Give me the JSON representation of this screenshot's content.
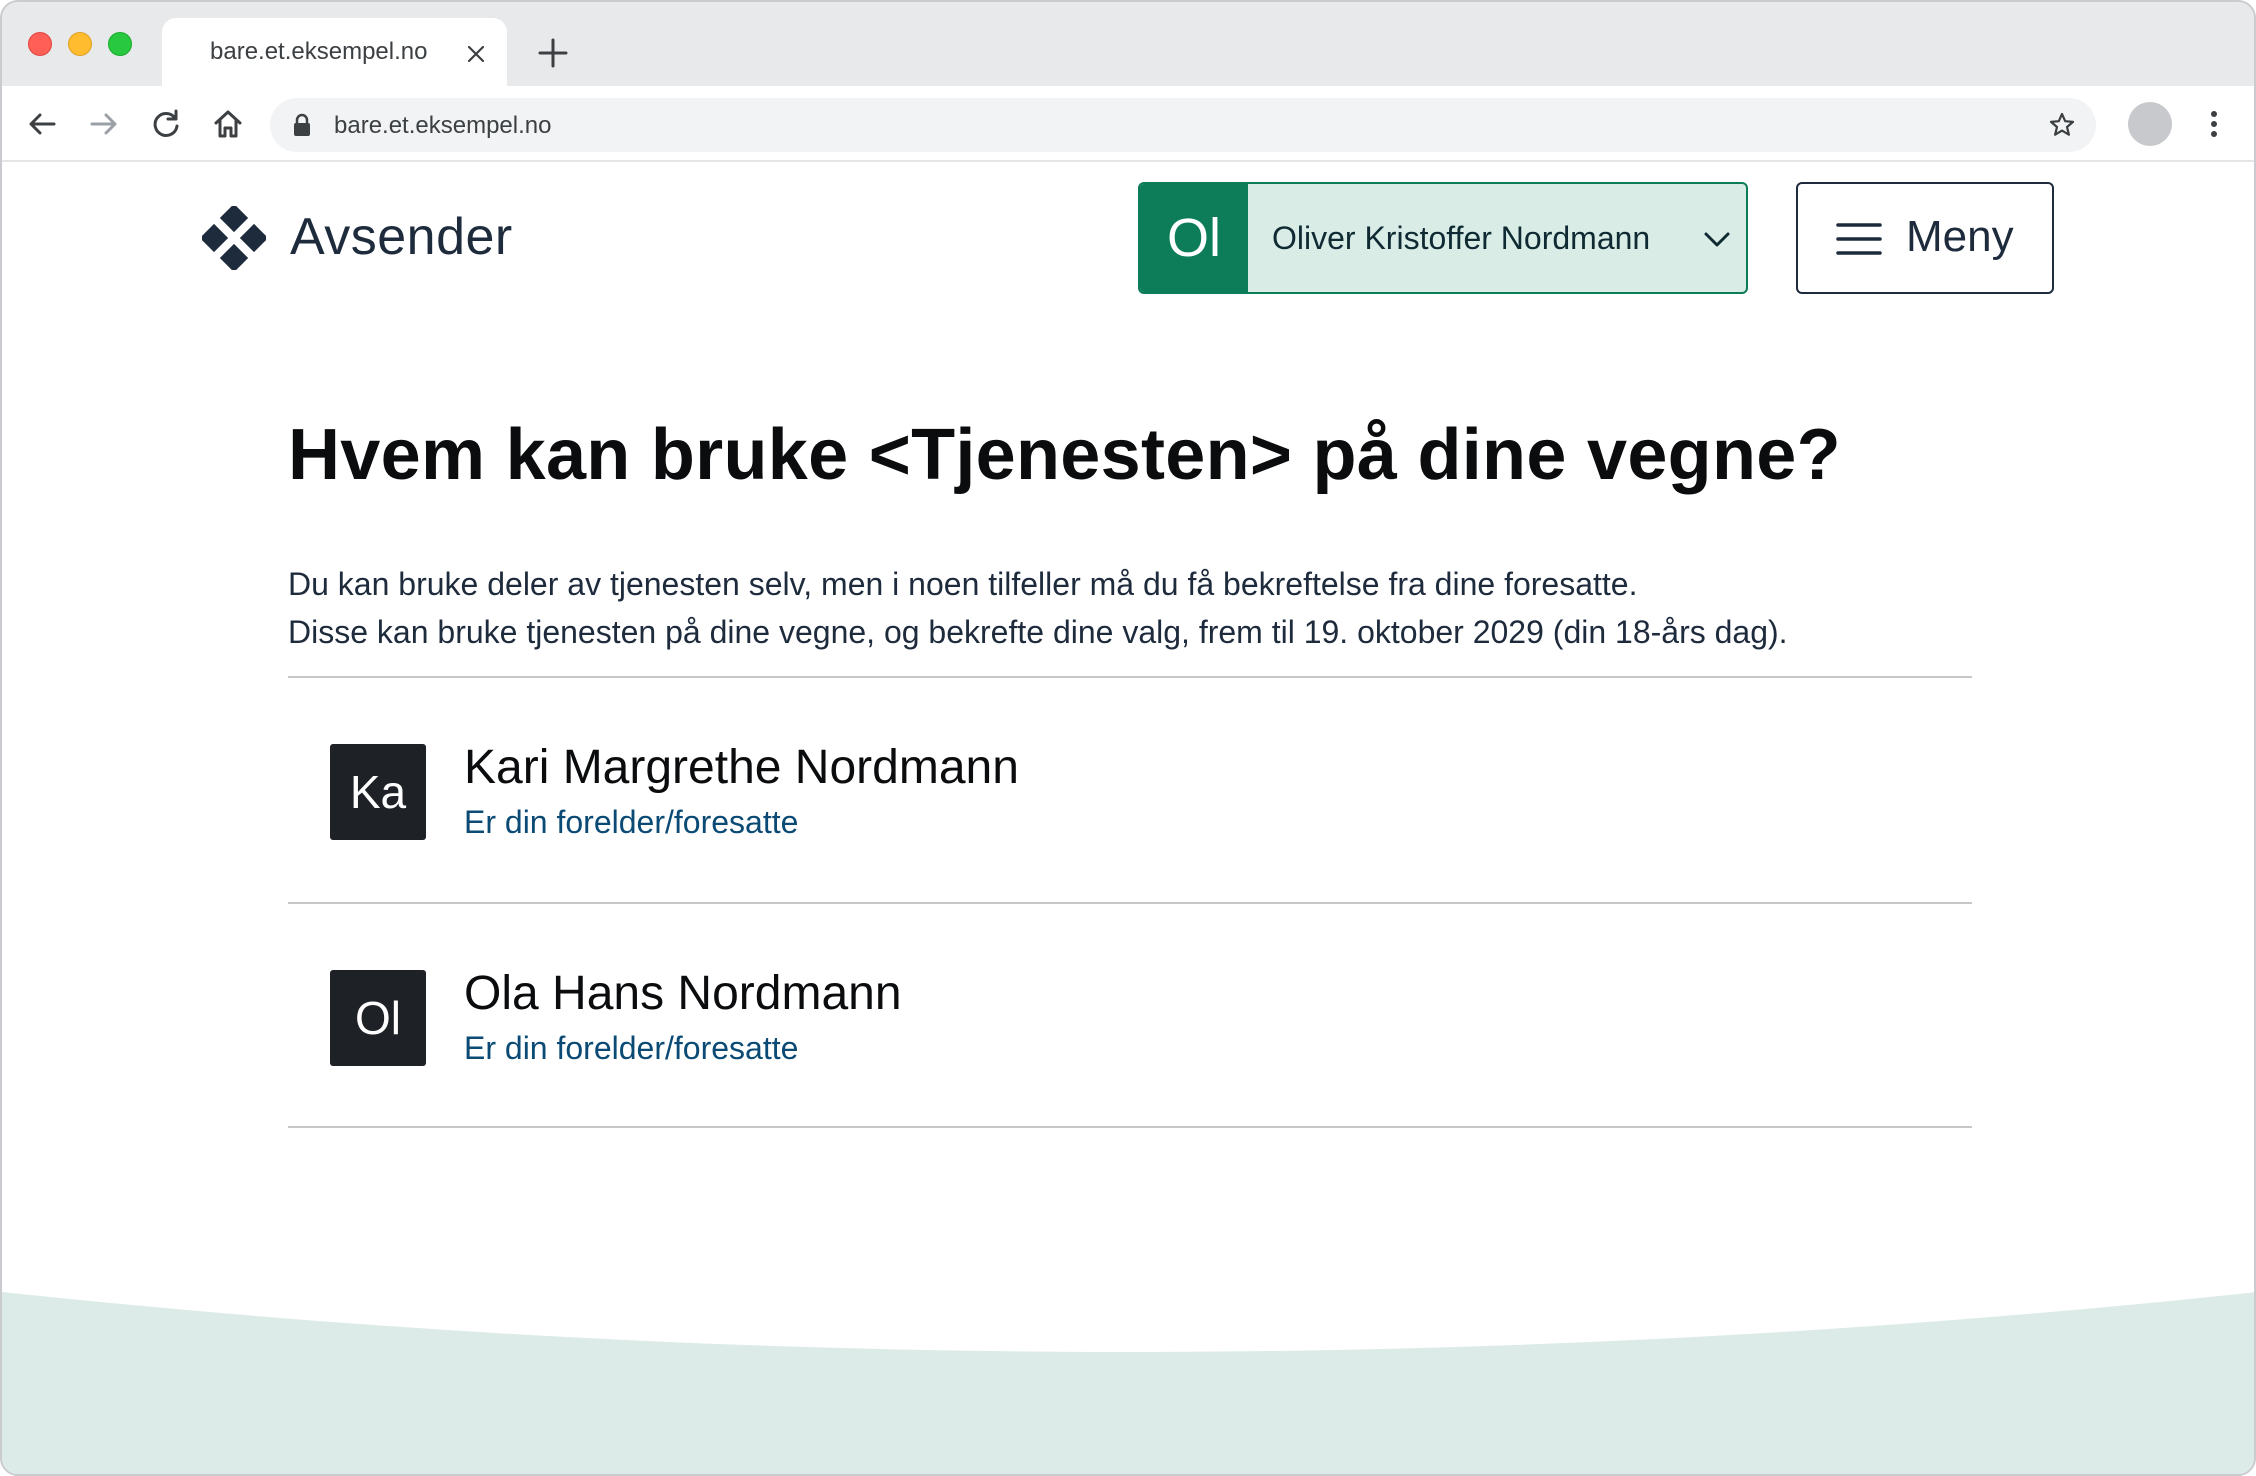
{
  "browser": {
    "tab_title": "bare.et.eksempel.no",
    "url": "bare.et.eksempel.no"
  },
  "header": {
    "logo_text": "Avsender",
    "user": {
      "initials": "Ol",
      "name": "Oliver Kristoffer Nordmann"
    },
    "menu_label": "Meny"
  },
  "main": {
    "heading": "Hvem kan bruke <Tjenesten> på dine vegne?",
    "intro_line1": "Du kan bruke deler av tjenesten selv, men i noen tilfeller må du få bekreftelse fra dine foresatte.",
    "intro_line2": "Disse kan bruke tjenesten på dine vegne, og bekrefte dine valg, frem til 19. oktober 2029 (din 18-års dag).",
    "people": [
      {
        "initials": "Ka",
        "name": "Kari Margrethe Nordmann",
        "role": "Er din forelder/foresatte"
      },
      {
        "initials": "Ol",
        "name": "Ola Hans Nordmann",
        "role": "Er din forelder/foresatte"
      }
    ]
  },
  "colors": {
    "brand_green": "#0c7c59",
    "brand_green_light": "#d9ece6",
    "text_dark": "#1e2b3c",
    "link_blue": "#0a4a75",
    "footer_wave": "#dcebe7"
  },
  "icons": {
    "logo": "diamond-grid-icon",
    "user_dropdown": "chevron-down-icon",
    "menu": "hamburger-icon",
    "tab_close": "close-icon",
    "new_tab": "plus-icon",
    "back": "arrow-left-icon",
    "forward": "arrow-right-icon",
    "reload": "reload-icon",
    "home": "home-icon",
    "secure": "lock-icon",
    "bookmark": "star-icon",
    "browser_menu": "kebab-icon"
  }
}
